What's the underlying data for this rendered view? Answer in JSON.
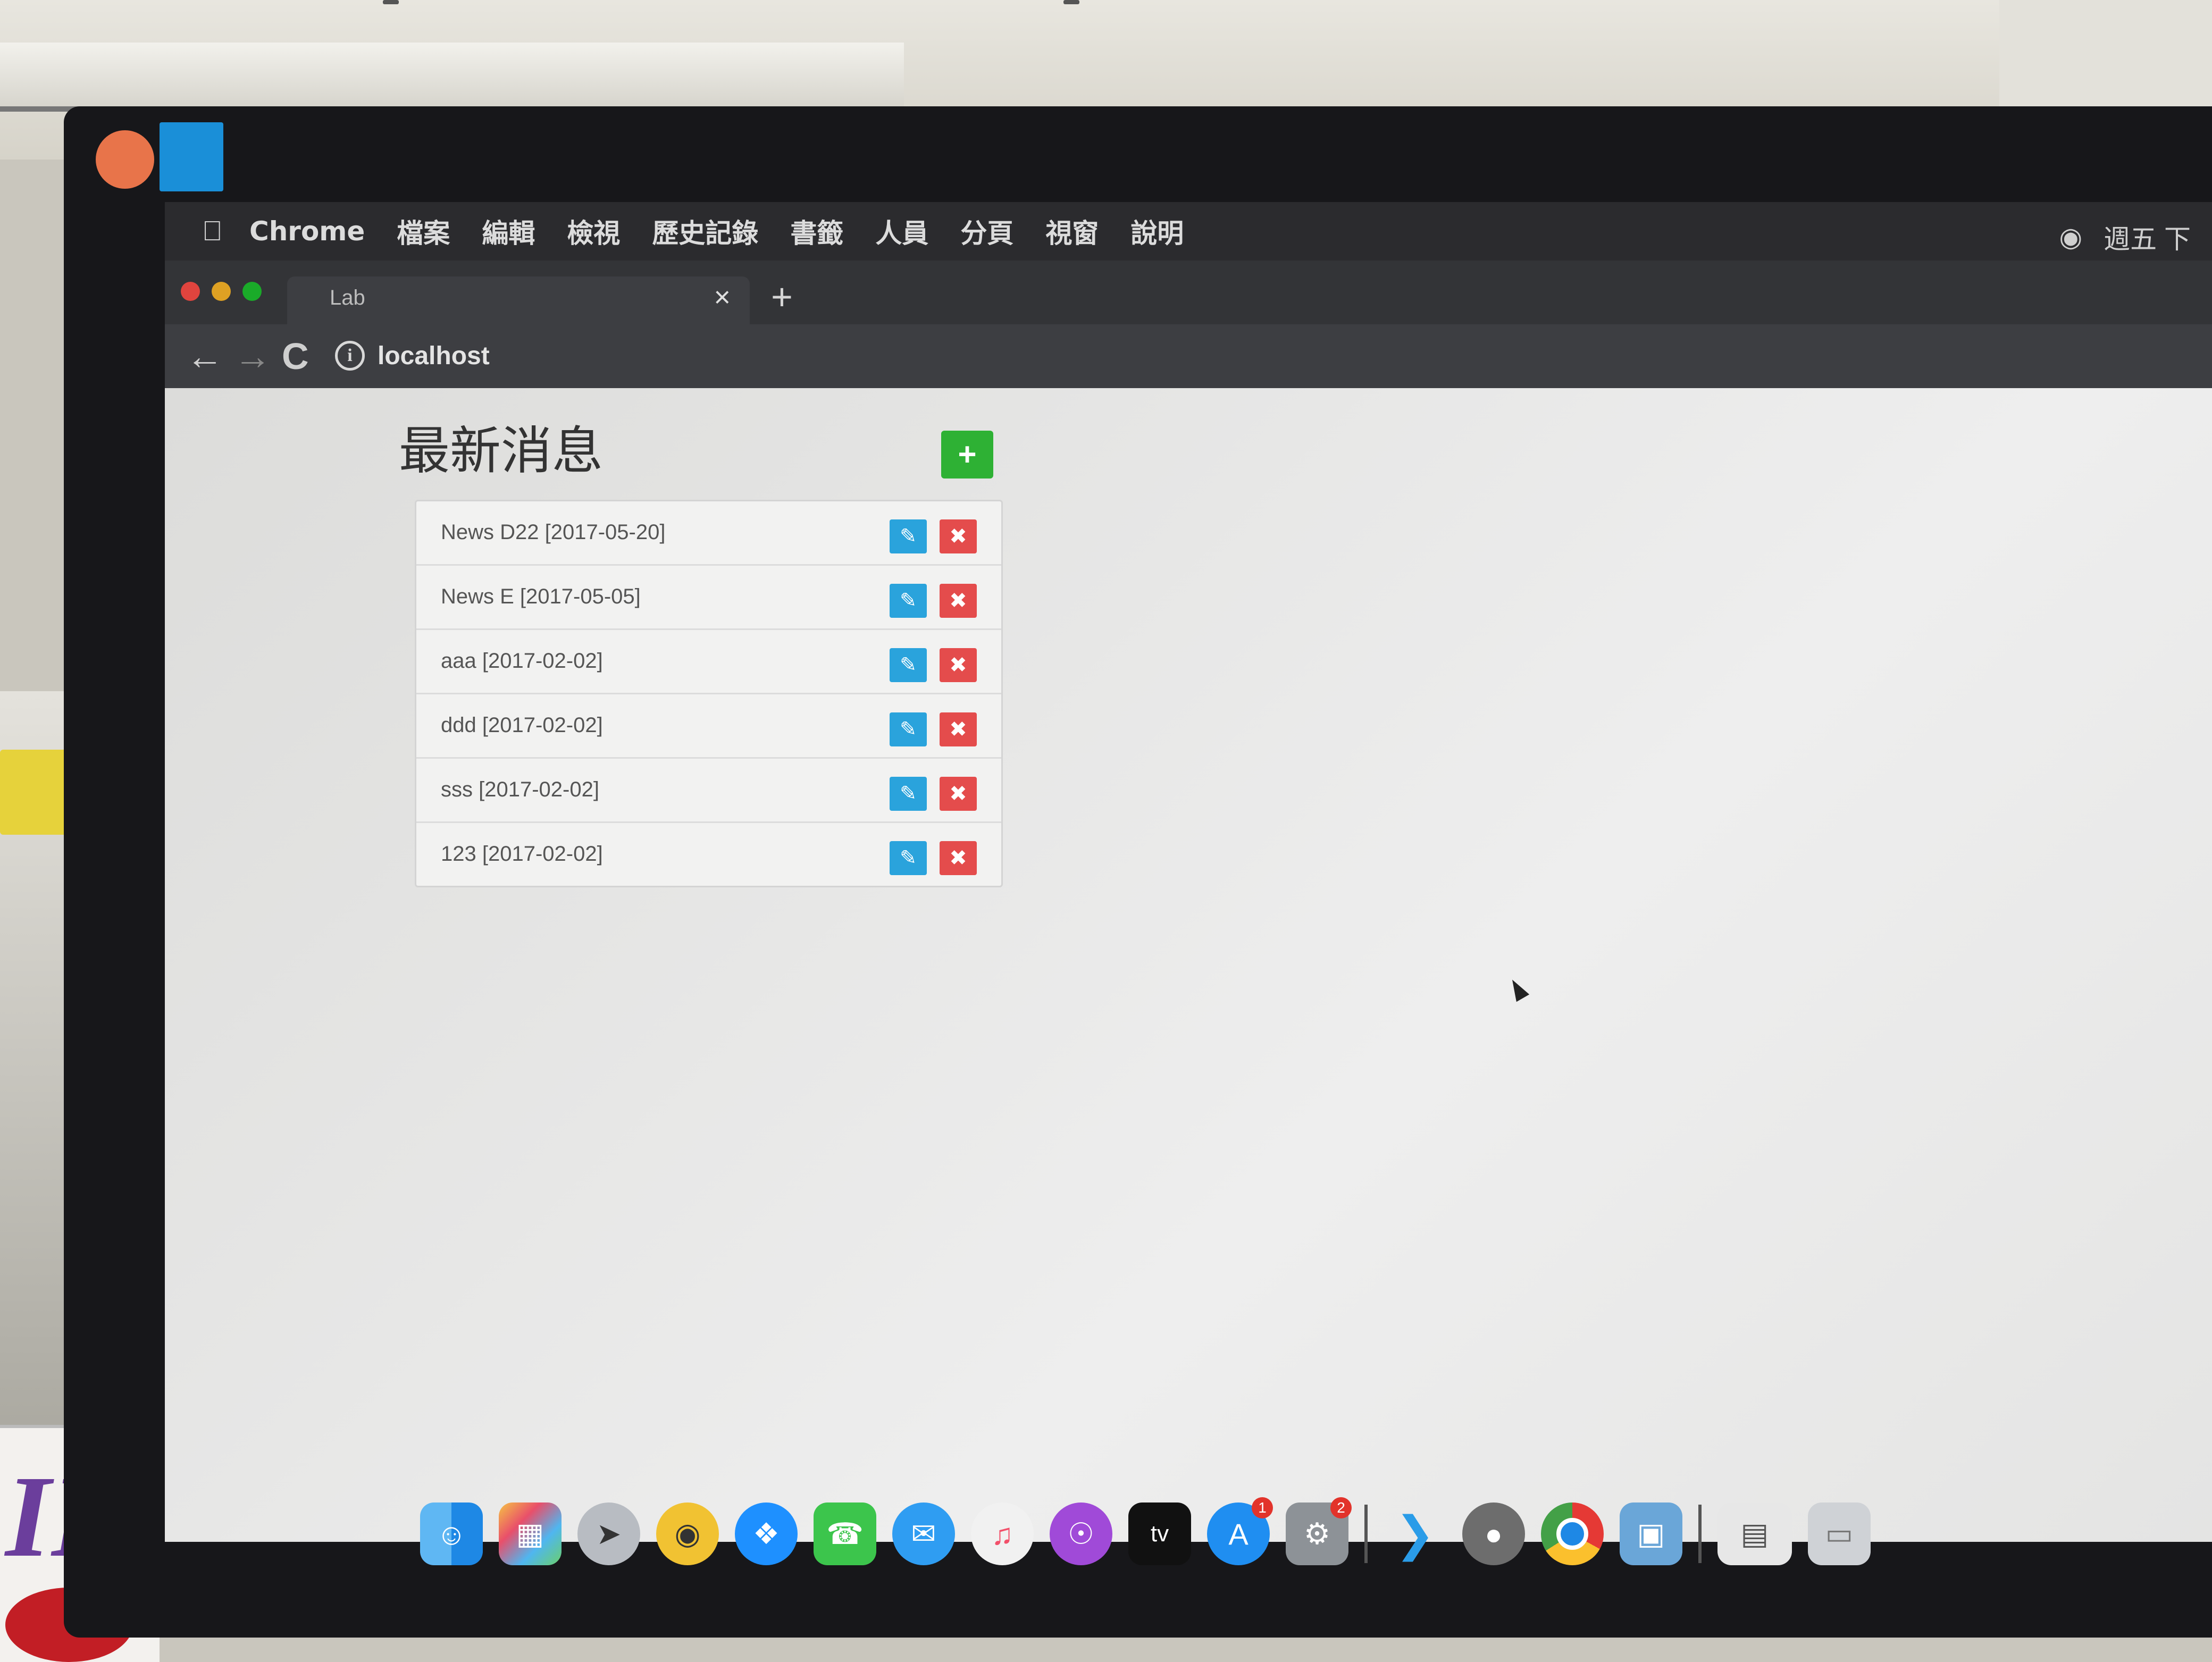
{
  "menubar": {
    "apple_icon": "apple-icon",
    "items": [
      "Chrome",
      "檔案",
      "編輯",
      "檢視",
      "歷史記錄",
      "書籤",
      "人員",
      "分頁",
      "視窗",
      "說明"
    ],
    "clock": "週五 下"
  },
  "tab": {
    "title": "Lab",
    "close": "×",
    "new_tab": "+"
  },
  "toolbar": {
    "back": "←",
    "forward": "→",
    "reload": "C",
    "url": "localhost"
  },
  "page": {
    "title": "最新消息",
    "add_button": "+",
    "edit_icon": "pencil-icon",
    "delete_icon": "close-icon",
    "news": [
      {
        "label": "News D22 [2017-05-20]"
      },
      {
        "label": "News E [2017-05-05]"
      },
      {
        "label": "aaa [2017-02-02]"
      },
      {
        "label": "ddd [2017-02-02]"
      },
      {
        "label": "sss [2017-02-02]"
      },
      {
        "label": "123 [2017-02-02]"
      }
    ]
  },
  "dock": {
    "app_store_badge": "1",
    "settings_badge": "2",
    "tv_label": "tv"
  },
  "colors": {
    "add": "#2eb134",
    "edit": "#2aa3dc",
    "delete": "#e44c4c"
  }
}
